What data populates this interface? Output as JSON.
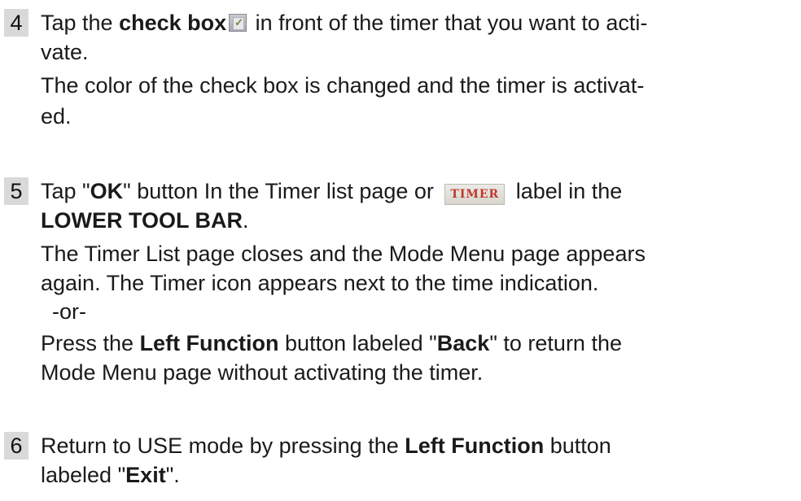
{
  "steps": [
    {
      "number": "4",
      "text": {
        "s1": "Tap the ",
        "b1": "check box",
        "s2": " in front of the timer that you want to acti-",
        "l2": "vate.",
        "l3": "The color of the check box is changed and the timer is activat-",
        "l4": "ed."
      },
      "icon": "checkbox-icon"
    },
    {
      "number": "5",
      "text": {
        "s1": "Tap \"",
        "b1": "OK",
        "s2": "\" button In the Timer list page or ",
        "label": "TIMER",
        "s3": " label in the",
        "b2": "LOWER TOOL BAR",
        "s4": ".",
        "l3": "The Timer List page closes and the Mode Menu page appears",
        "l4": "again. The Timer icon appears next to the time indication.",
        "l5": "-or-",
        "l6a": "Press the ",
        "l6b": "Left Function",
        "l6c": " button labeled \"",
        "l6d": "Back",
        "l6e": "\" to return the",
        "l7": "Mode Menu page without activating the timer."
      },
      "label_color": "#c0392b"
    },
    {
      "number": "6",
      "text": {
        "s1": "Return to USE mode by pressing the ",
        "b1": "Left Function",
        "s2": " button",
        "l2a": "labeled \"",
        "l2b": "Exit",
        "l2c": "\"."
      }
    }
  ]
}
